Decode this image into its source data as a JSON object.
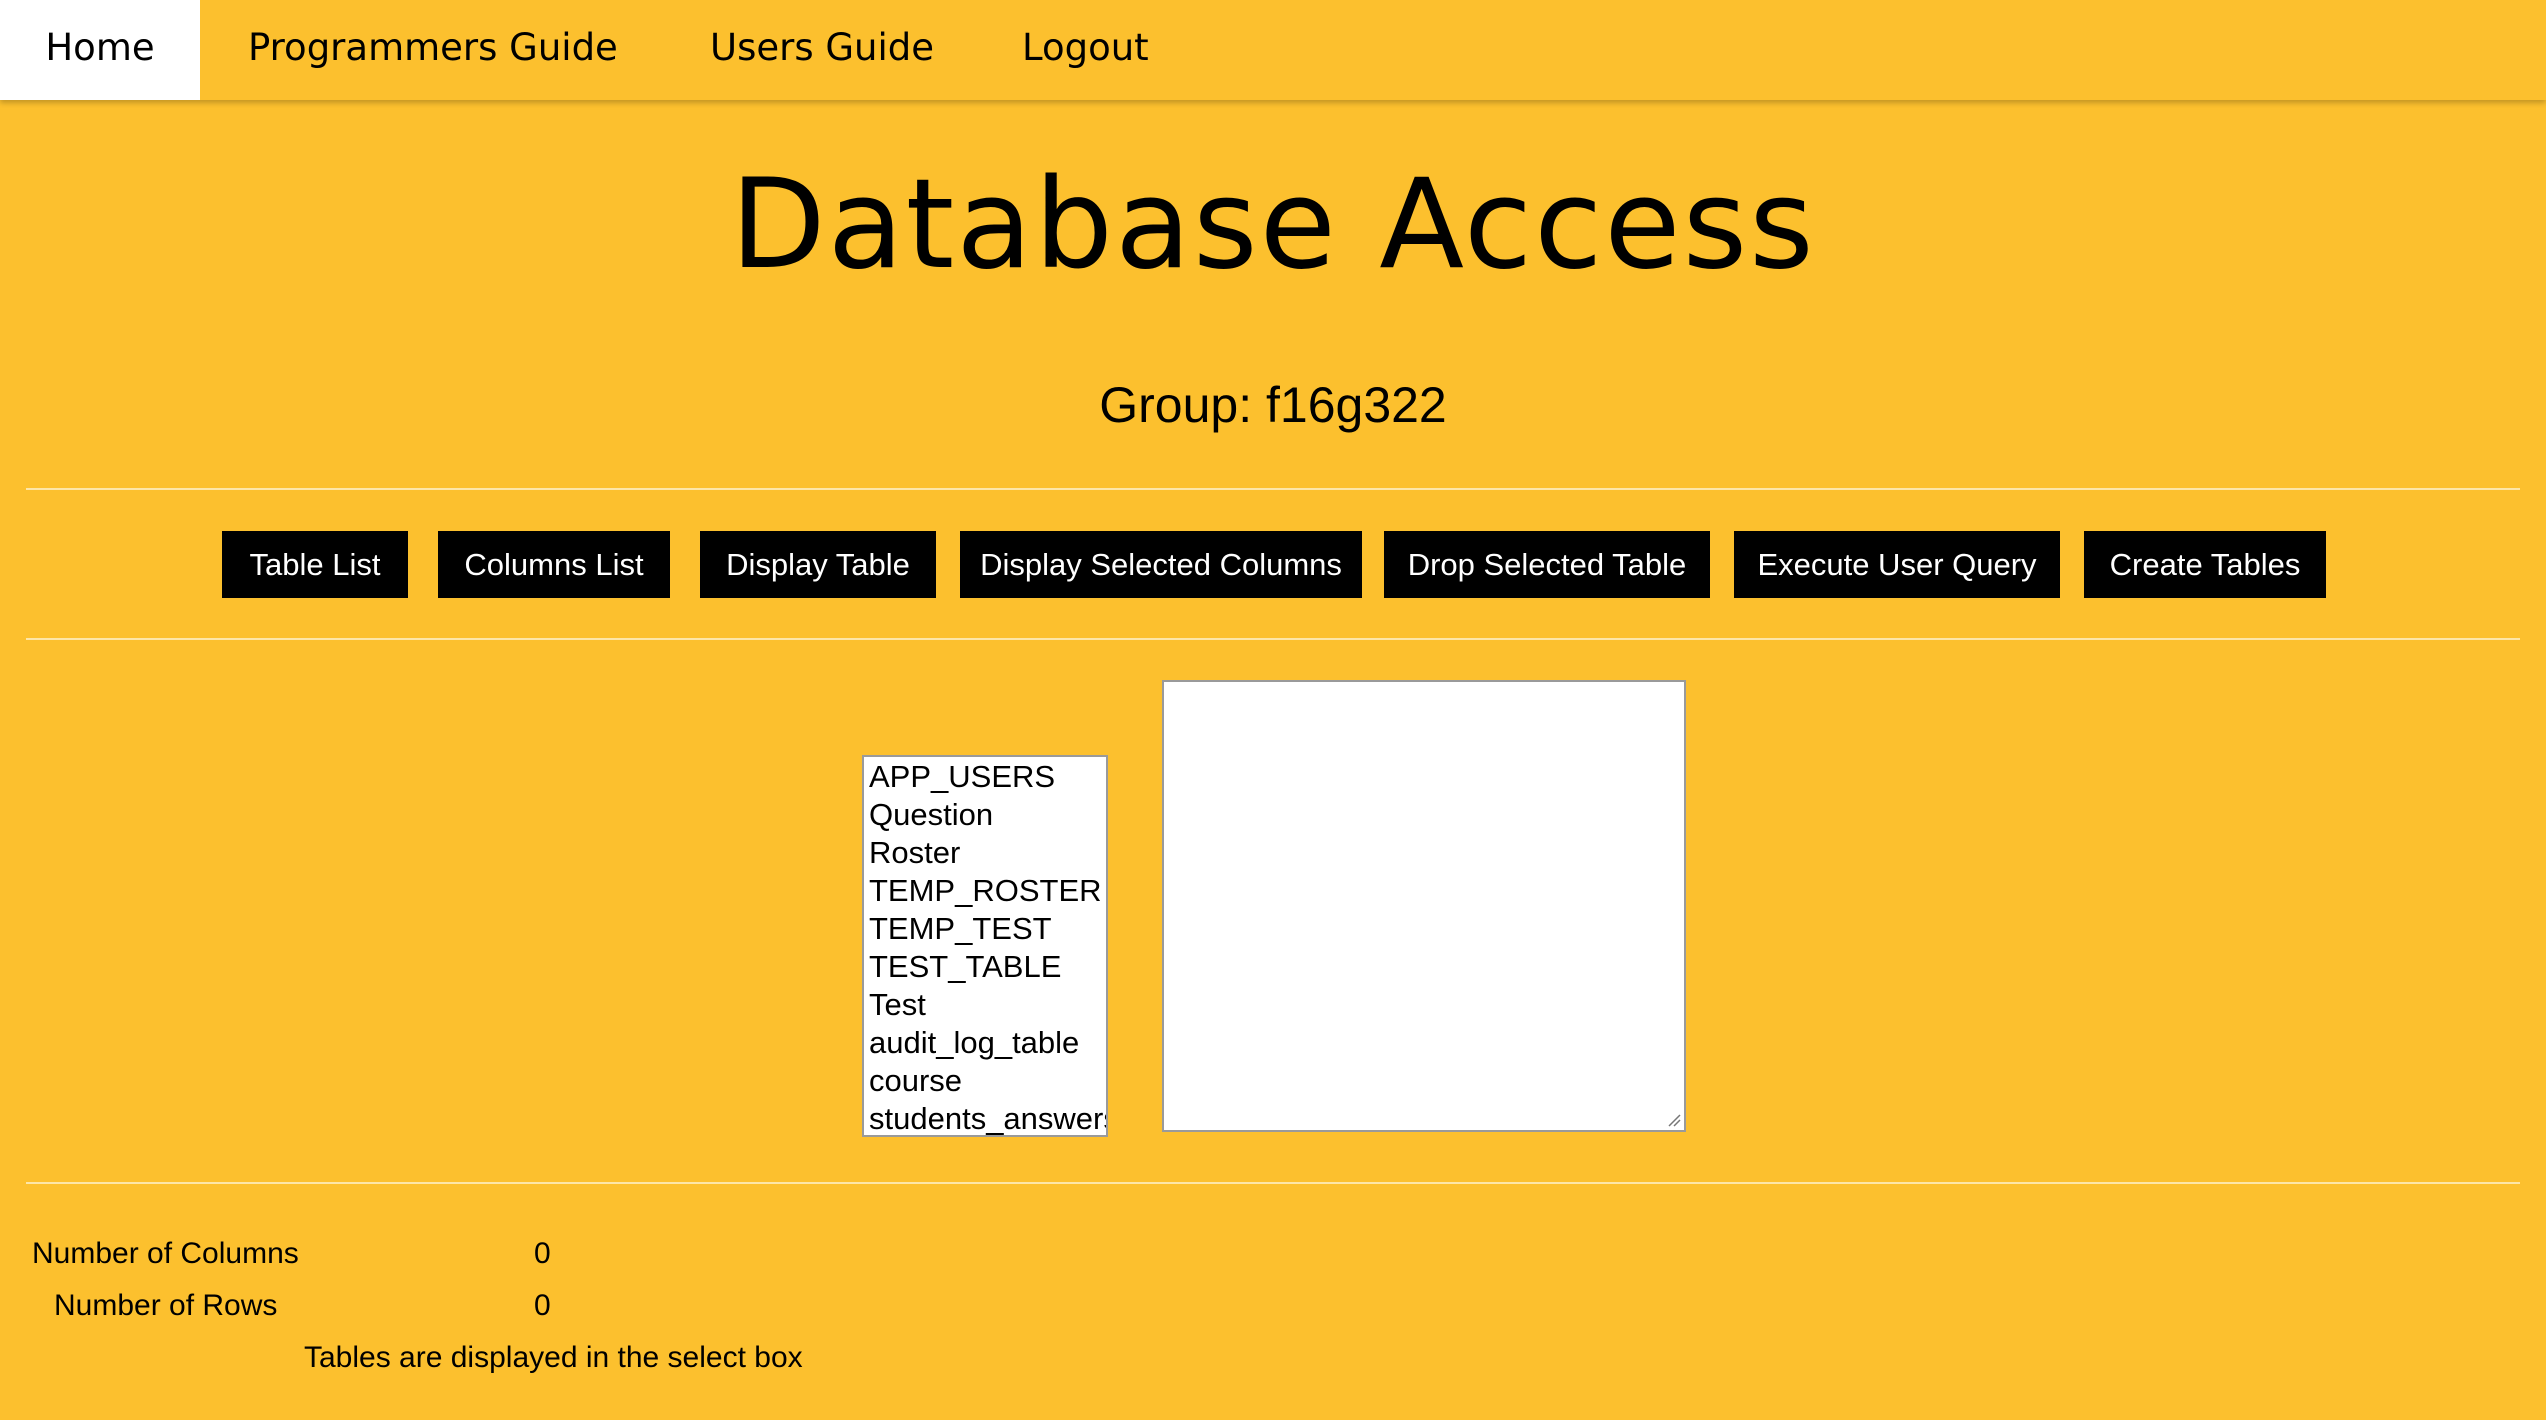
{
  "nav": {
    "home": "Home",
    "programmers_guide": "Programmers Guide",
    "users_guide": "Users Guide",
    "logout": "Logout"
  },
  "title": "Database Access",
  "group": "Group: f16g322",
  "buttons": {
    "table_list": "Table List",
    "columns_list": "Columns List",
    "display_table": "Display Table",
    "display_selected_columns": "Display Selected Columns",
    "drop_selected_table": "Drop Selected Table",
    "execute_user_query": "Execute User Query",
    "create_tables": "Create Tables"
  },
  "tables": [
    "APP_USERS",
    "Question",
    "Roster",
    "TEMP_ROSTER",
    "TEMP_TEST",
    "TEST_TABLE",
    "Test",
    "audit_log_table",
    "course",
    "students_answers"
  ],
  "query": {
    "value": ""
  },
  "stats": {
    "columns_label": "Number of Columns",
    "columns_value": "0",
    "rows_label": "Number of Rows",
    "rows_value": "0",
    "message": "Tables are displayed in the select box"
  },
  "colors": {
    "background": "#fcc02e",
    "button": "#000000",
    "button_text": "#ffffff",
    "active_tab": "#ffffff"
  }
}
